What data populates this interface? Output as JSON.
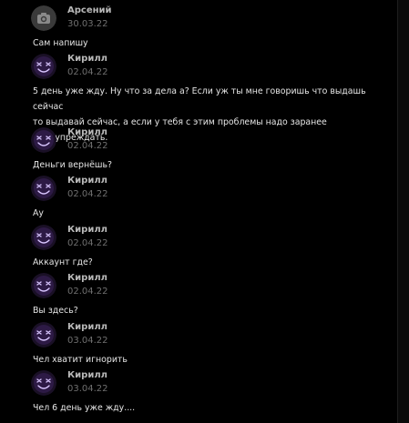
{
  "chat": {
    "messages": [
      {
        "author": "Арсений",
        "date": "30.03.22",
        "text": "Сам напишу",
        "avatar": "camera-icon"
      },
      {
        "author": "Кирилл",
        "date": "02.04.22",
        "text": "5 день уже жду. Ну что за дела а? Если уж ты мне говоришь что выдашь сейчас\nто выдавай сейчас, а если у тебя с этим проблемы надо заранее\nпредупреждать.",
        "avatar": "smiley-icon"
      },
      {
        "author": "Кирилл",
        "date": "02.04.22",
        "text": "Деньги вернёшь?",
        "avatar": "smiley-icon"
      },
      {
        "author": "Кирилл",
        "date": "02.04.22",
        "text": "Ау",
        "avatar": "smiley-icon"
      },
      {
        "author": "Кирилл",
        "date": "02.04.22",
        "text": "Аккаунт где?",
        "avatar": "smiley-icon"
      },
      {
        "author": "Кирилл",
        "date": "02.04.22",
        "text": "Вы здесь?",
        "avatar": "smiley-icon"
      },
      {
        "author": "Кирилл",
        "date": "03.04.22",
        "text": "Чел хватит игнорить",
        "avatar": "smiley-icon"
      },
      {
        "author": "Кирилл",
        "date": "03.04.22",
        "text": "Чел 6 день уже жду....",
        "avatar": "smiley-icon"
      }
    ]
  },
  "colors": {
    "background": "#000000",
    "author": "#b8b8b8",
    "date": "#6f6f6f",
    "text": "#e6e6e6",
    "avatar_purple": "#4a2a6e"
  }
}
